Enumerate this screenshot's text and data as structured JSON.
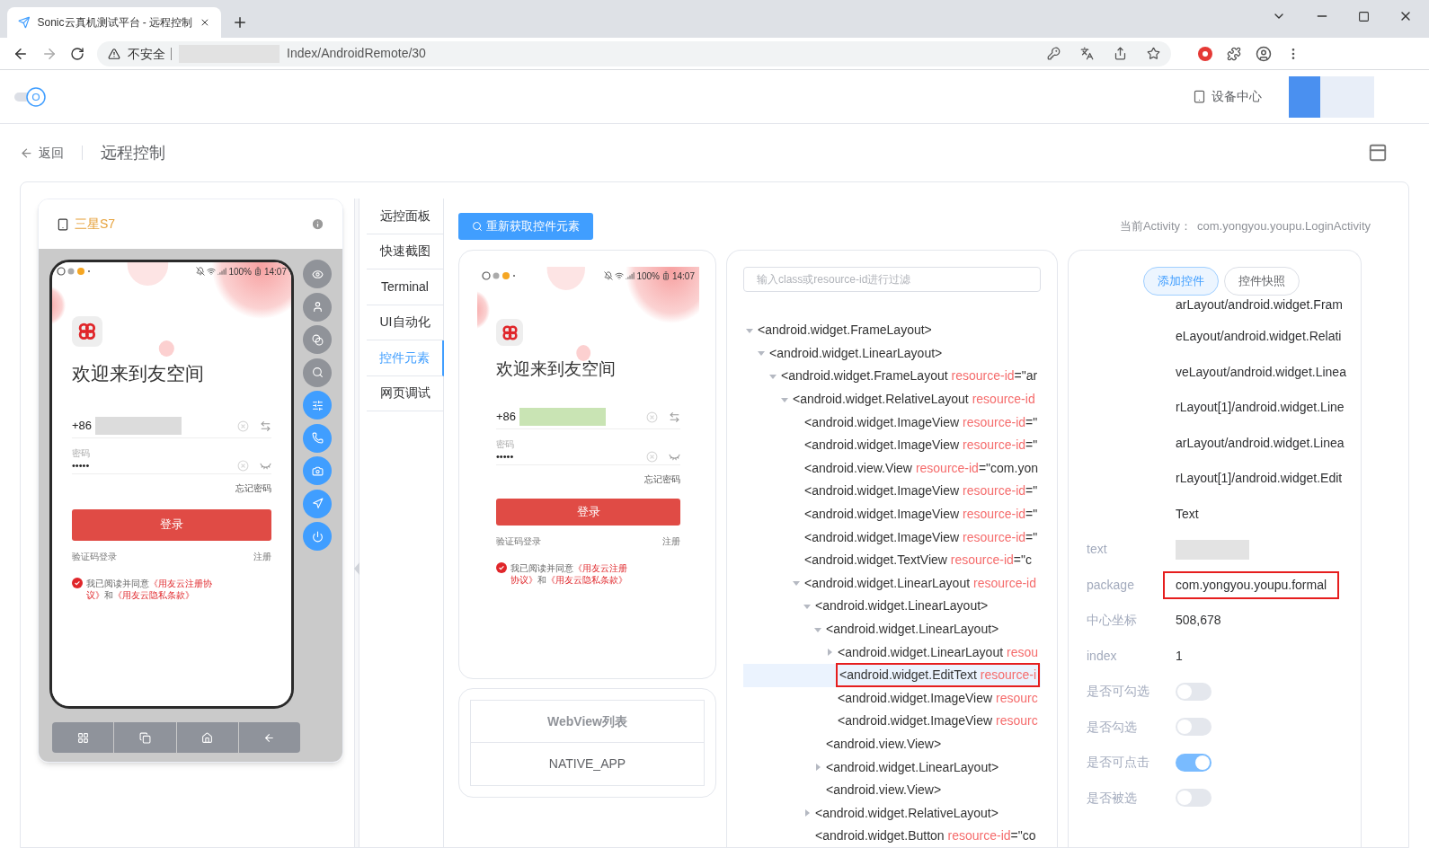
{
  "browser": {
    "tab_title": "Sonic云真机测试平台 - 远程控制",
    "security": "不安全",
    "url": "Index/AndroidRemote/30"
  },
  "header": {
    "device_center": "设备中心"
  },
  "page": {
    "back": "返回",
    "title": "远程控制"
  },
  "device": {
    "name": "三星S7",
    "phone": {
      "battery": "100%",
      "time": "14:07",
      "title": "欢迎来到友空间",
      "country_code": "+86",
      "password_label": "密码",
      "password": "•••••",
      "forgot": "忘记密码",
      "login": "登录",
      "sms_login": "验证码登录",
      "register": "注册",
      "agreed": true,
      "agreement": [
        {
          "text": "我已阅读并同意",
          "kind": "plain"
        },
        {
          "text": "《用友云注册协议》",
          "kind": "link"
        },
        {
          "text": "和",
          "kind": "plain"
        },
        {
          "text": "《用友云隐私条款》",
          "kind": "link"
        }
      ]
    },
    "side_buttons": [
      {
        "enabled": false
      },
      {
        "enabled": false
      },
      {
        "enabled": false
      },
      {
        "enabled": false
      },
      {
        "enabled": true
      },
      {
        "enabled": true
      },
      {
        "enabled": true
      },
      {
        "enabled": true
      },
      {
        "enabled": true
      }
    ]
  },
  "tabs": [
    {
      "label": "远控面板",
      "selected": false
    },
    {
      "label": "快速截图",
      "selected": false
    },
    {
      "label": "Terminal",
      "selected": false
    },
    {
      "label": "UI自动化",
      "selected": false
    },
    {
      "label": "控件元素",
      "selected": true
    },
    {
      "label": "网页调试",
      "selected": false
    }
  ],
  "refresh_button": "重新获取控件元素",
  "activity": {
    "label": "当前Activity：",
    "value": "com.yongyou.youpu.LoginActivity"
  },
  "screenshot": {
    "phone": {
      "battery": "100%",
      "time": "14:07",
      "title": "欢迎来到友空间",
      "country_code": "+86",
      "password_label": "密码",
      "password": "•••••",
      "forgot": "忘记密码",
      "login": "登录",
      "sms_login": "验证码登录",
      "register": "注册",
      "agreed": true,
      "agreement": [
        {
          "text": "我已阅读并同意",
          "kind": "plain"
        },
        {
          "text": "《用友云注册协议》",
          "kind": "link"
        },
        {
          "text": "和",
          "kind": "plain"
        },
        {
          "text": "《用友云隐私条款》",
          "kind": "link"
        }
      ]
    }
  },
  "webview": {
    "title": "WebView列表",
    "items": [
      "NATIVE_APP"
    ]
  },
  "tree": {
    "filter_placeholder": "输入class或resource-id进行过滤",
    "nodes": [
      {
        "tag": "<android.widget.FrameLayout>",
        "kind": "branch",
        "expanded": true,
        "selected": false,
        "children": [
          {
            "tag": "<android.widget.LinearLayout>",
            "kind": "branch",
            "expanded": true,
            "selected": false,
            "children": [
              {
                "tag": "<android.widget.FrameLayout",
                "attr": "resource-id",
                "value": "=\"ar",
                "kind": "branch",
                "expanded": true,
                "selected": false,
                "children": [
                  {
                    "tag": "<android.widget.RelativeLayout",
                    "attr": "resource-id",
                    "kind": "branch",
                    "expanded": true,
                    "selected": false,
                    "children": [
                      {
                        "tag": "<android.widget.ImageView",
                        "attr": "resource-id",
                        "value": "=\"",
                        "kind": "leaf",
                        "selected": false
                      },
                      {
                        "tag": "<android.widget.ImageView",
                        "attr": "resource-id",
                        "value": "=\"",
                        "kind": "leaf",
                        "selected": false
                      },
                      {
                        "tag": "<android.view.View",
                        "attr": "resource-id",
                        "value": "=\"com.yon",
                        "kind": "leaf",
                        "selected": false
                      },
                      {
                        "tag": "<android.widget.ImageView",
                        "attr": "resource-id",
                        "value": "=\"",
                        "kind": "leaf",
                        "selected": false
                      },
                      {
                        "tag": "<android.widget.ImageView",
                        "attr": "resource-id",
                        "value": "=\"",
                        "kind": "leaf",
                        "selected": false
                      },
                      {
                        "tag": "<android.widget.ImageView",
                        "attr": "resource-id",
                        "value": "=\"",
                        "kind": "leaf",
                        "selected": false
                      },
                      {
                        "tag": "<android.widget.TextView",
                        "attr": "resource-id",
                        "value": "=\"c",
                        "kind": "leaf",
                        "selected": false
                      },
                      {
                        "tag": "<android.widget.LinearLayout",
                        "attr": "resource-id",
                        "kind": "branch",
                        "expanded": true,
                        "selected": false,
                        "children": [
                          {
                            "tag": "<android.widget.LinearLayout>",
                            "kind": "branch",
                            "expanded": true,
                            "selected": false,
                            "children": [
                              {
                                "tag": "<android.widget.LinearLayout>",
                                "kind": "branch",
                                "expanded": true,
                                "selected": false,
                                "children": [
                                  {
                                    "tag": "<android.widget.LinearLayout",
                                    "attr": "resou",
                                    "kind": "branch",
                                    "expanded": false,
                                    "selected": false
                                  },
                                  {
                                    "tag": "<android.widget.EditText",
                                    "attr": "resource-i",
                                    "kind": "leaf",
                                    "selected": true,
                                    "annotated": true
                                  },
                                  {
                                    "tag": "<android.widget.ImageView",
                                    "attr": "resourc",
                                    "kind": "leaf",
                                    "selected": false
                                  },
                                  {
                                    "tag": "<android.widget.ImageView",
                                    "attr": "resourc",
                                    "kind": "leaf",
                                    "selected": false
                                  }
                                ]
                              },
                              {
                                "tag": "<android.view.View>",
                                "kind": "leaf",
                                "selected": false
                              },
                              {
                                "tag": "<android.widget.LinearLayout>",
                                "kind": "branch",
                                "expanded": false,
                                "selected": false
                              },
                              {
                                "tag": "<android.view.View>",
                                "kind": "leaf",
                                "selected": false
                              }
                            ]
                          },
                          {
                            "tag": "<android.widget.RelativeLayout>",
                            "kind": "branch",
                            "expanded": false,
                            "selected": false
                          },
                          {
                            "tag": "<android.widget.Button",
                            "attr": "resource-id",
                            "value": "=\"co",
                            "kind": "leaf",
                            "selected": false
                          }
                        ]
                      }
                    ]
                  }
                ]
              }
            ]
          }
        ]
      }
    ]
  },
  "details": {
    "tabs": [
      {
        "label": "添加控件",
        "selected": true
      },
      {
        "label": "控件快照",
        "selected": false
      }
    ],
    "xpath_lines": [
      "arLayout/android.widget.Fram",
      "eLayout/android.widget.Relati",
      "veLayout/android.widget.Linea",
      "rLayout[1]/android.widget.Line",
      "arLayout/android.widget.Linea",
      "rLayout[1]/android.widget.Edit",
      "Text"
    ],
    "rows": [
      {
        "label": "text",
        "kind": "blurred"
      },
      {
        "label": "package",
        "kind": "text",
        "value": "com.yongyou.youpu.formal",
        "annotated": true
      },
      {
        "label": "中心坐标",
        "kind": "text",
        "value": "508,678"
      },
      {
        "label": "index",
        "kind": "text",
        "value": "1"
      },
      {
        "label": "是否可勾选",
        "kind": "toggle",
        "on": false
      },
      {
        "label": "是否勾选",
        "kind": "toggle",
        "on": false
      },
      {
        "label": "是否可点击",
        "kind": "toggle",
        "on": true
      },
      {
        "label": "是否被选",
        "kind": "toggle",
        "on": false
      }
    ]
  }
}
